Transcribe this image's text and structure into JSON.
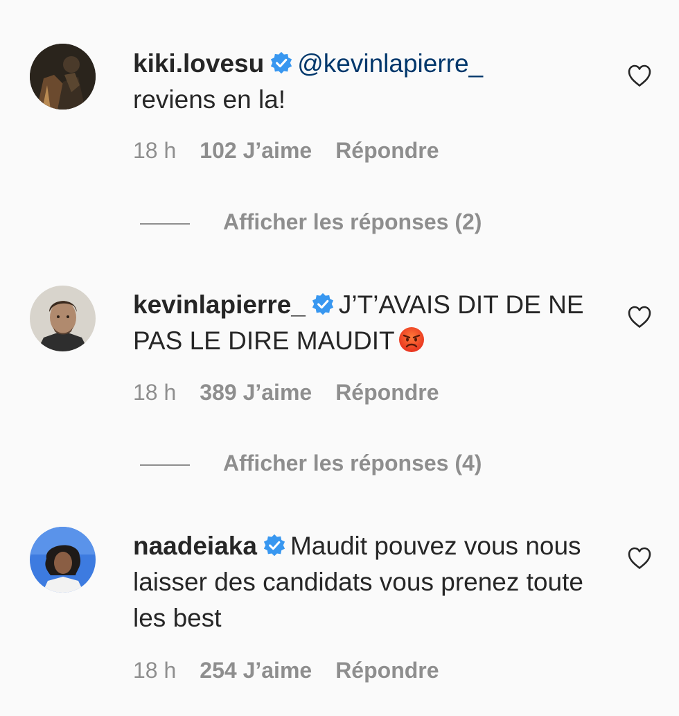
{
  "comments": [
    {
      "username": "kiki.lovesu",
      "mention": "@kevinlapierre_",
      "text": "reviens en la!",
      "time": "18 h",
      "likes": "102 J’aime",
      "reply": "Répondre",
      "replies": "Afficher les réponses (2)",
      "avatar_icon": "avatar-photo-dark"
    },
    {
      "username": "kevinlapierre_",
      "text": "J’T’AVAIS DIT DE NE PAS LE DIRE MAUDIT",
      "emoji": "angry-face-emoji",
      "time": "18 h",
      "likes": "389 J’aime",
      "reply": "Répondre",
      "replies": "Afficher les réponses (4)",
      "avatar_icon": "avatar-photo-portrait"
    },
    {
      "username": "naadeiaka",
      "text": "Maudit pouvez vous nous laisser des candidats vous prenez toute les best",
      "time": "18 h",
      "likes": "254 J’aime",
      "reply": "Répondre",
      "avatar_icon": "avatar-photo-blue"
    }
  ],
  "colors": {
    "background": "#fafafa",
    "text": "#262626",
    "secondary": "#8e8e8e",
    "mention": "#00376b",
    "verified": "#3897f0"
  }
}
